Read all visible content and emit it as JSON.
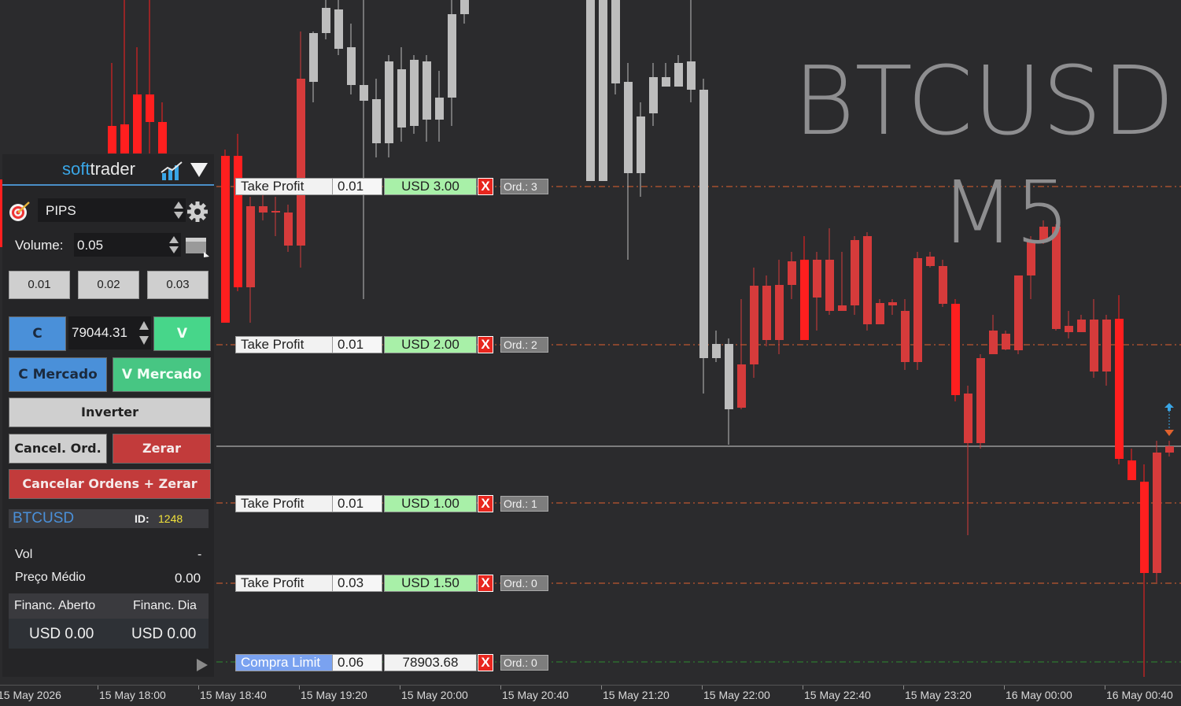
{
  "chart": {
    "symbol": "BTCUSD",
    "timeframe": "M5",
    "bull_color": "#bdbdbd",
    "bear_color": "#d63b3b",
    "bright_color": "#ff1f1f",
    "current_price_line_color": "#cfcfcf",
    "order_line_color": "#e0622e",
    "buy_limit_line_color": "#2e8b2e"
  },
  "x_axis": [
    "15 May 2026",
    "15 May 18:00",
    "15 May 18:40",
    "15 May 19:20",
    "15 May 20:00",
    "15 May 20:40",
    "15 May 21:20",
    "15 May 22:00",
    "15 May 22:40",
    "15 May 23:20",
    "16 May 00:00",
    "16 May 00:40"
  ],
  "orders": [
    {
      "name": "Take Profit",
      "volume": "0.01",
      "value": "USD 3.00",
      "close": "X",
      "ord": "Ord.: 3"
    },
    {
      "name": "Take Profit",
      "volume": "0.01",
      "value": "USD 2.00",
      "close": "X",
      "ord": "Ord.: 2"
    },
    {
      "name": "Take Profit",
      "volume": "0.01",
      "value": "USD 1.00",
      "close": "X",
      "ord": "Ord.: 1"
    },
    {
      "name": "Take Profit",
      "volume": "0.03",
      "value": "USD 1.50",
      "close": "X",
      "ord": "Ord.: 0"
    },
    {
      "name": "Compra Limit",
      "volume": "0.06",
      "value": "78903.68",
      "close": "X",
      "ord": "Ord.: 0"
    }
  ],
  "panel": {
    "brand_soft": "soft",
    "brand_trader": "trader",
    "mode_select": "PIPS",
    "volume_label": "Volume:",
    "volume_value": "0.05",
    "presets": [
      "0.01",
      "0.02",
      "0.03"
    ],
    "buy_label": "C",
    "price_value": "79044.31",
    "sell_label": "V",
    "buy_market_label": "C Mercado",
    "sell_market_label": "V Mercado",
    "invert_label": "Inverter",
    "cancel_orders_label": "Cancel. Ord.",
    "zero_label": "Zerar",
    "cancel_all_label": "Cancelar Ordens + Zerar",
    "symbol": "BTCUSD",
    "id_label": "ID:",
    "id_value": "1248",
    "vol_label": "Vol",
    "vol_value": "-",
    "avg_price_label": "Preço Médio",
    "avg_price_value": "0.00",
    "open_fin_label": "Financ. Aberto",
    "day_fin_label": "Financ. Dia",
    "open_fin_value": "USD 0.00",
    "day_fin_value": "USD 0.00"
  }
}
